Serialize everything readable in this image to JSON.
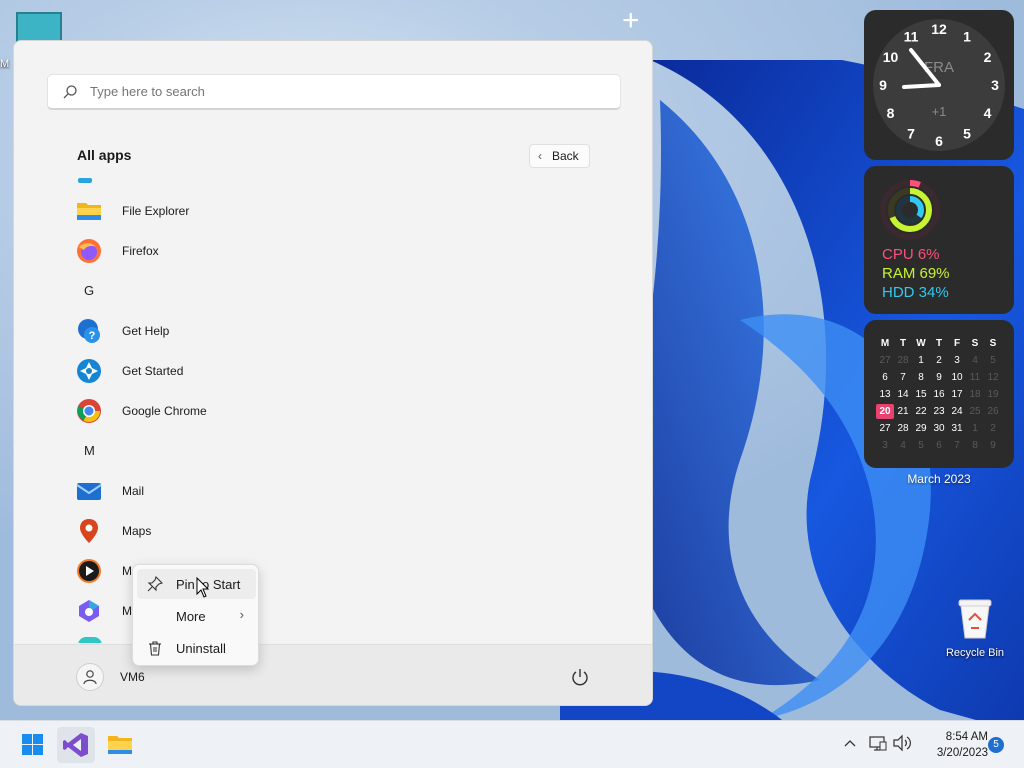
{
  "desktop": {
    "top_icon_label": "M",
    "recycle_bin_label": "Recycle Bin"
  },
  "widgets": {
    "clock": {
      "numerals": [
        "12",
        "1",
        "2",
        "3",
        "4",
        "5",
        "6",
        "7",
        "8",
        "9",
        "10",
        "11"
      ],
      "watermark": "FRA",
      "offset": "+1"
    },
    "meter": {
      "cpu": "CPU 6%",
      "ram": "RAM 69%",
      "hdd": "HDD 34%",
      "cpu_color": "#ff4f7b",
      "ram_color": "#c6f432",
      "hdd_color": "#32c8f2"
    },
    "calendar": {
      "weekdays": [
        "M",
        "T",
        "W",
        "T",
        "F",
        "S",
        "S"
      ],
      "weeks": [
        [
          "27",
          "28",
          "1",
          "2",
          "3",
          "4",
          "5"
        ],
        [
          "6",
          "7",
          "8",
          "9",
          "10",
          "11",
          "12"
        ],
        [
          "13",
          "14",
          "15",
          "16",
          "17",
          "18",
          "19"
        ],
        [
          "20",
          "21",
          "22",
          "23",
          "24",
          "25",
          "26"
        ],
        [
          "27",
          "28",
          "29",
          "30",
          "31",
          "1",
          "2"
        ],
        [
          "3",
          "4",
          "5",
          "6",
          "7",
          "8",
          "9"
        ]
      ],
      "today": "20",
      "caption": "March 2023"
    }
  },
  "start_menu": {
    "search_placeholder": "Type here to search",
    "all_apps_title": "All apps",
    "back_label": "Back",
    "items": [
      {
        "type": "app",
        "label": "File Explorer",
        "icon": "file-explorer-icon"
      },
      {
        "type": "app",
        "label": "Firefox",
        "icon": "firefox-icon"
      },
      {
        "type": "letter",
        "label": "G"
      },
      {
        "type": "app",
        "label": "Get Help",
        "icon": "get-help-icon"
      },
      {
        "type": "app",
        "label": "Get Started",
        "icon": "get-started-icon"
      },
      {
        "type": "app",
        "label": "Google Chrome",
        "icon": "chrome-icon"
      },
      {
        "type": "letter",
        "label": "M"
      },
      {
        "type": "app",
        "label": "Mail",
        "icon": "mail-icon"
      },
      {
        "type": "app",
        "label": "Maps",
        "icon": "maps-icon"
      },
      {
        "type": "app",
        "label": "M",
        "icon": "media-player-icon"
      },
      {
        "type": "app",
        "label": "M",
        "icon": "microsoft-365-icon"
      }
    ],
    "user_name": "VM6"
  },
  "context_menu": {
    "pin_label": "Pin to Start",
    "more_label": "More",
    "uninstall_label": "Uninstall"
  },
  "taskbar": {
    "time": "8:54 AM",
    "date": "3/20/2023",
    "notification_count": "5"
  }
}
